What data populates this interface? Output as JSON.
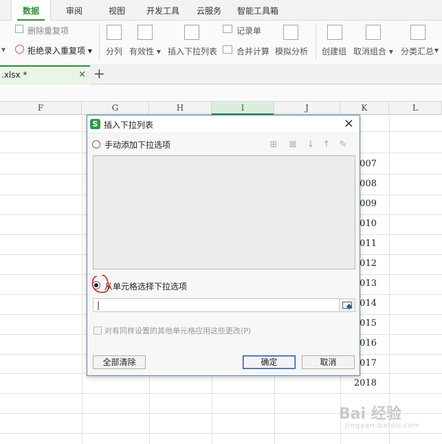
{
  "ribbon_tabs": [
    "数据",
    "审阅",
    "视图",
    "开发工具",
    "云服务",
    "智能工具箱"
  ],
  "active_ribbon_tab": "数据",
  "ribbon": {
    "remove_duplicates": "删除重复项",
    "reject_duplicates": "拒绝录入重复项",
    "split_column": "分列",
    "validity": "有效性",
    "insert_dropdown": "插入下拉列表",
    "record_sheet": "记录单",
    "merge_calc": "合并计算",
    "simulate": "模拟分析",
    "create_group": "创建组",
    "ungroup": "取消组合",
    "subtotal": "分类汇总"
  },
  "file_tab": {
    "name": ".xlsx *",
    "close": "×"
  },
  "add_tab": "+",
  "columns": [
    "F",
    "G",
    "H",
    "I",
    "J",
    "K",
    "L"
  ],
  "selected_column": "I",
  "cells_k": [
    "007",
    "008",
    "009",
    "010",
    "011",
    "012",
    "013",
    "014",
    "015",
    "016",
    "017",
    "2018"
  ],
  "watermark": {
    "text": "Bai 经验",
    "sub": "jingyan.baidu.com"
  },
  "dialog": {
    "title": "插入下拉列表",
    "logo": "S",
    "close": "×",
    "option_manual": "手动添加下拉选项",
    "option_cells": "从单元格选择下拉选项",
    "selected_option": "cells",
    "reference_value": "|",
    "apply_all_label": "对有同样设置的其他单元格应用这些更改(P)",
    "clear_all": "全部清除",
    "ok": "确定",
    "cancel": "取消",
    "tool_icons": [
      "add-item-icon",
      "delete-item-icon",
      "move-down-icon",
      "move-up-icon",
      "edit-icon"
    ]
  },
  "colors": {
    "accent": "#2f8e3c",
    "dialog_border": "#5c87b8",
    "annotation": "#e02020"
  }
}
